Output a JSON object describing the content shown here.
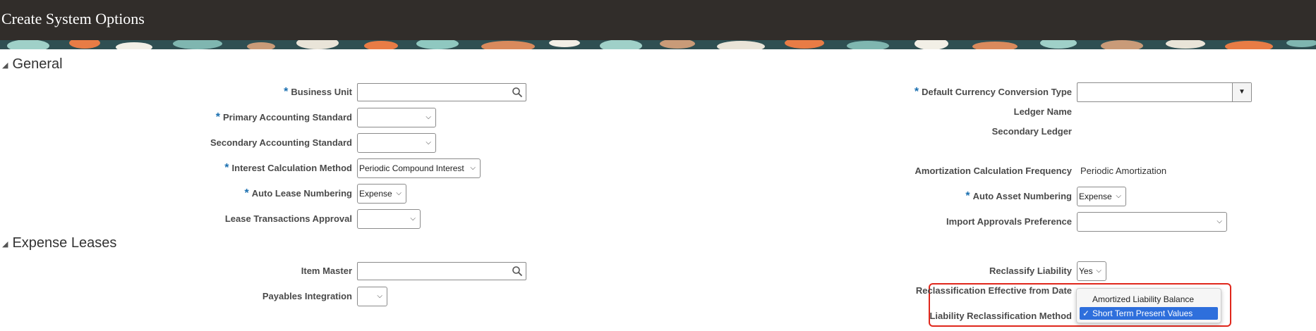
{
  "header": {
    "title": "Create System Options"
  },
  "general": {
    "title": "General",
    "business_unit": {
      "label": "Business Unit",
      "required": "*",
      "value": ""
    },
    "primary_accounting_standard": {
      "label": "Primary Accounting Standard",
      "required": "*",
      "value": ""
    },
    "secondary_accounting_standard": {
      "label": "Secondary Accounting Standard",
      "value": ""
    },
    "interest_calculation_method": {
      "label": "Interest Calculation Method",
      "required": "*",
      "value": "Periodic Compound Interest"
    },
    "auto_lease_numbering": {
      "label": "Auto Lease Numbering",
      "required": "*",
      "value": "Expense"
    },
    "lease_transactions_approval": {
      "label": "Lease Transactions Approval",
      "value": ""
    },
    "default_currency_conversion_type": {
      "label": "Default Currency Conversion Type",
      "required": "*",
      "value": ""
    },
    "ledger_name": {
      "label": "Ledger Name"
    },
    "secondary_ledger": {
      "label": "Secondary Ledger"
    },
    "amortization_calculation_frequency": {
      "label": "Amortization Calculation Frequency",
      "value": "Periodic Amortization"
    },
    "auto_asset_numbering": {
      "label": "Auto Asset Numbering",
      "required": "*",
      "value": "Expense"
    },
    "import_approvals_preference": {
      "label": "Import Approvals Preference",
      "value": ""
    }
  },
  "expense_leases": {
    "title": "Expense Leases",
    "item_master": {
      "label": "Item Master",
      "value": ""
    },
    "payables_integration": {
      "label": "Payables Integration",
      "value": ""
    },
    "reclassify_liability": {
      "label": "Reclassify Liability",
      "value": "Yes"
    },
    "reclassification_effective_from_date": {
      "label": "Reclassification Effective from Date"
    },
    "liability_reclassification_method": {
      "label": "Liability Reclassification Method",
      "options": [
        "Amortized Liability Balance",
        "Short Term Present Values"
      ],
      "selected": "Short Term Present Values"
    }
  },
  "icons": {
    "search": "magnifier-icon",
    "chevron": "chevron-down-icon",
    "collapse": "triangle-collapse-icon",
    "check": "check-icon"
  },
  "colors": {
    "header_bg": "#312d2a",
    "required": "#1a6fb0",
    "highlight": "#e0271c",
    "selected_option": "#2e6fdc"
  }
}
